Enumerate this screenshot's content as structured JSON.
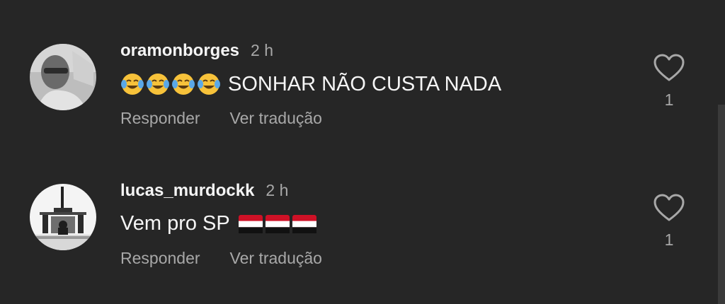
{
  "comments": [
    {
      "username": "oramonborges",
      "time": "2 h",
      "emoji_prefix": "😂😂😂😂",
      "text": "SONHAR NÃO CUSTA NADA",
      "flags": "",
      "reply_label": "Responder",
      "translate_label": "Ver tradução",
      "like_count": "1"
    },
    {
      "username": "lucas_murdockk",
      "time": "2 h",
      "emoji_prefix": "",
      "text": "Vem pro SP",
      "flags": "🇾🇪🇾🇪🇾🇪",
      "reply_label": "Responder",
      "translate_label": "Ver tradução",
      "like_count": "1"
    }
  ],
  "icons": {
    "like": "heart-outline-icon",
    "emoji": "tears-of-joy-emoji-icon",
    "flag": "red-white-black-flag-icon"
  },
  "colors": {
    "background": "#262626",
    "primary_text": "#f5f5f5",
    "secondary_text": "#a8a8a8",
    "emoji_yellow": "#f7c23a",
    "flag_red": "#ce1126"
  }
}
